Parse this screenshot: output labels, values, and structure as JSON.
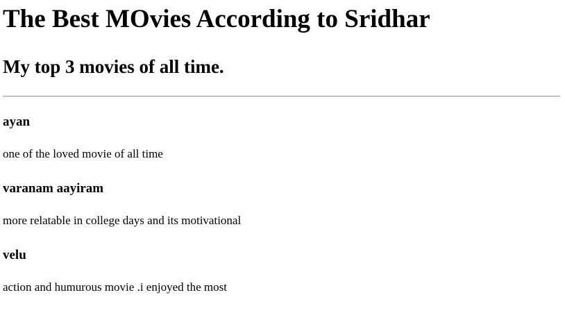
{
  "page": {
    "title": "The Best MOvies According to Sridhar",
    "subtitle": "My top 3 movies of all time."
  },
  "movies": [
    {
      "name": "ayan",
      "description": "one of the loved movie of all time"
    },
    {
      "name": "varanam aayiram",
      "description": "more relatable in college days and its motivational"
    },
    {
      "name": "velu",
      "description": "action and humurous movie .i enjoyed the most"
    }
  ]
}
